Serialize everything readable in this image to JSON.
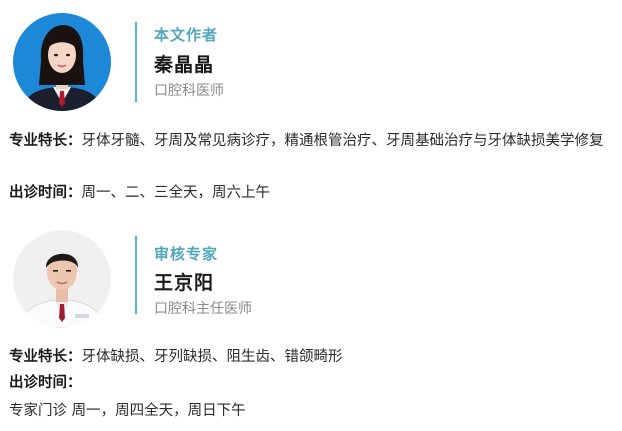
{
  "author": {
    "role": "本文作者",
    "name": "秦晶晶",
    "title": "口腔科医师",
    "specialty_label": "专业特长：",
    "specialty_text": "牙体牙髓、牙周及常见病诊疗，精通根管治疗、牙周基础治疗与牙体缺损美学修复",
    "hours_label": "出诊时间：",
    "hours_text": "周一、二、三全天，周六上午",
    "avatar_bg": "#1e88d8"
  },
  "reviewer": {
    "role": "审核专家",
    "name": "王京阳",
    "title": "口腔科主任医师",
    "specialty_label": "专业特长：",
    "specialty_text": "牙体缺损、牙列缺损、阻生齿、错颌畸形",
    "hours_label": "出诊时间：",
    "hours_text": "",
    "clinic_text": "专家门诊  周一，周四全天，周日下午",
    "avatar_bg": "#f0f0f0"
  },
  "colors": {
    "accent": "#4fa7b9",
    "divider": "#5ab5c6"
  }
}
